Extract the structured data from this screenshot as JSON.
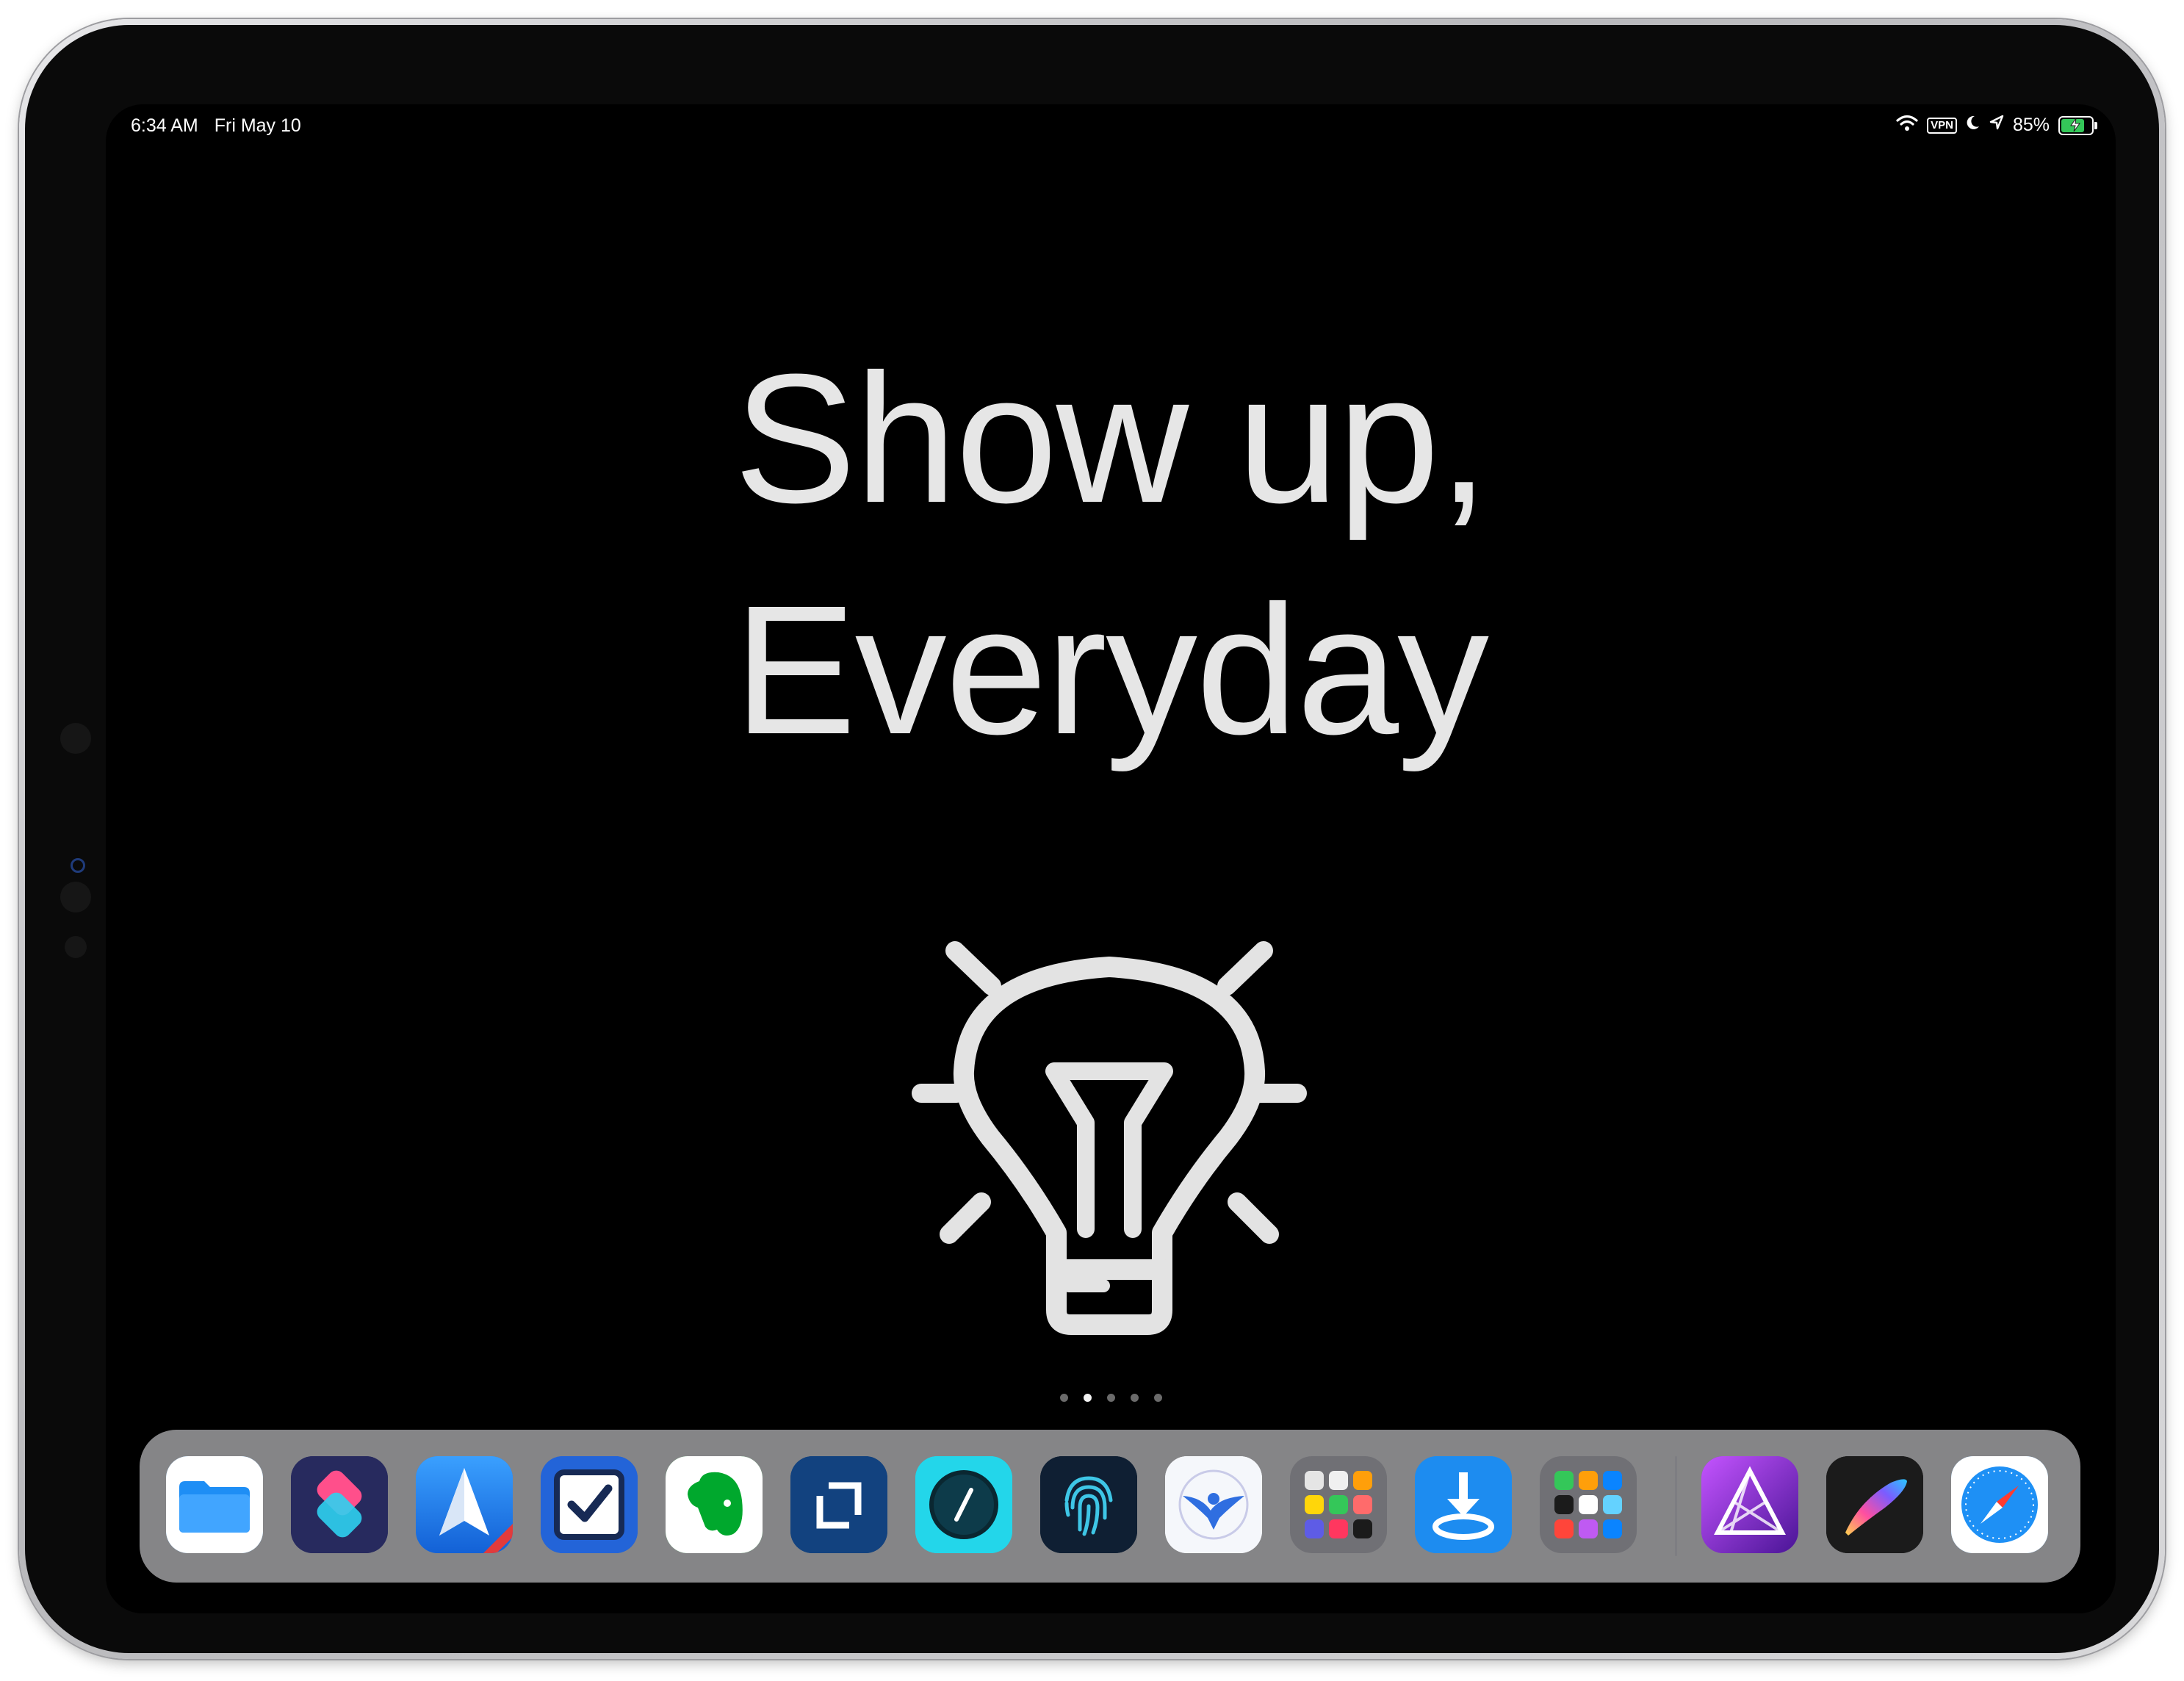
{
  "status_bar": {
    "time": "6:34 AM",
    "date": "Fri May 10",
    "vpn_label": "VPN",
    "battery_text": "85%",
    "battery_level": 0.85,
    "icons": [
      "wifi-icon",
      "vpn-icon",
      "moon-icon",
      "location-arrow-icon",
      "battery-icon",
      "charging-bolt-icon"
    ]
  },
  "wallpaper": {
    "line1": "Show up,",
    "line2": "Everyday",
    "illustration": "lightbulb-icon",
    "text_color": "#e6e6e6"
  },
  "page_indicator": {
    "count": 5,
    "active_index": 1
  },
  "dock": {
    "apps": [
      {
        "name": "files-app-icon",
        "color": "#1e8ef5"
      },
      {
        "name": "shortcuts-app-icon",
        "color": "#2b2e6b"
      },
      {
        "name": "spark-mail-app-icon",
        "color": "#1f73e8"
      },
      {
        "name": "omnifocus-checkbox-app-icon",
        "color": "#2364d8"
      },
      {
        "name": "evernote-app-icon",
        "color": "#00a82d"
      },
      {
        "name": "scanner-crop-app-icon",
        "color": "#12427f"
      },
      {
        "name": "pencil-circle-app-icon",
        "color": "#21d4e8"
      },
      {
        "name": "fingerprint-app-icon",
        "color": "#0f1f33"
      },
      {
        "name": "bird-app-icon",
        "color": "#f5f7fb"
      },
      {
        "name": "app-folder-1-icon",
        "color": "#6e6e73"
      },
      {
        "name": "download-app-icon",
        "color": "#1d8cf0"
      },
      {
        "name": "app-folder-2-icon",
        "color": "#6e6e73"
      },
      {
        "name": "affinity-photo-app-icon",
        "color": "#7b2fc9"
      },
      {
        "name": "procreate-app-icon",
        "color": "#1b1b1b"
      },
      {
        "name": "safari-app-icon",
        "color": "#1e90f5"
      }
    ]
  }
}
